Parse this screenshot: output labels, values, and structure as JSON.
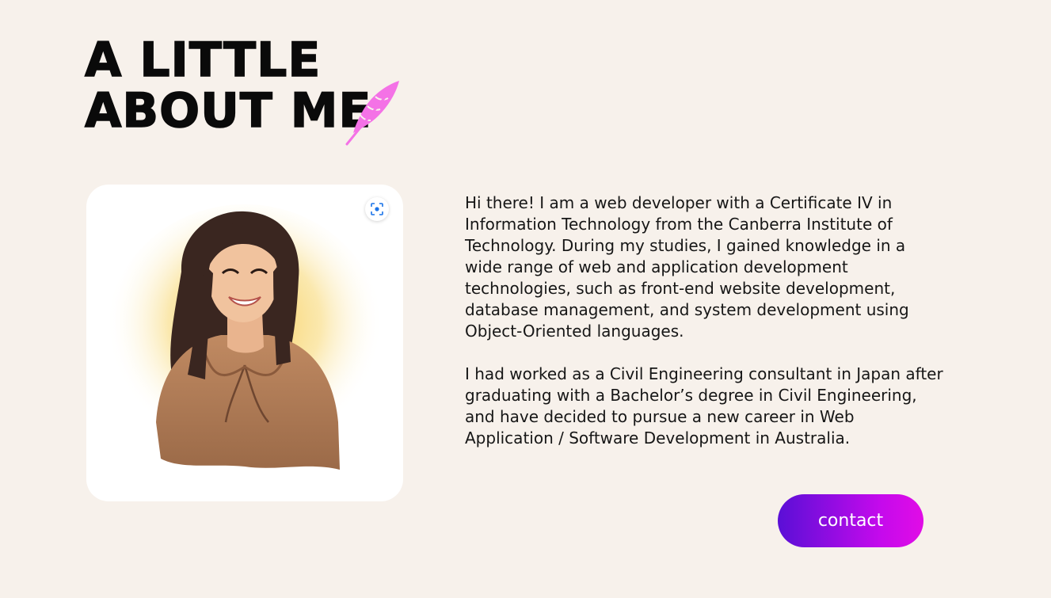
{
  "heading": {
    "line1": "A LITTLE",
    "line2": "ABOUT ME"
  },
  "bio": {
    "paragraph1": "Hi there! I am a web developer with a Certificate IV in Information Technology from the Canberra Institute of Technology. During my studies, I gained knowledge in a wide range of web and application development technologies, such as front-end website development, database management, and system development using Object-Oriented languages.",
    "paragraph2": "I had worked as a Civil Engineering consultant in Japan after graduating with a Bachelor’s degree in Civil Engineering, and have decided to pursue a new career in Web Application / Software Development in Australia."
  },
  "contact": {
    "label": "contact"
  },
  "icons": {
    "decoration": "quill-feather-icon",
    "photo_action": "visual-search-icon"
  },
  "colors": {
    "background": "#f7f1eb",
    "quill": "#f472e6",
    "button_start": "#5a0fd6",
    "button_end": "#e10ce6"
  }
}
